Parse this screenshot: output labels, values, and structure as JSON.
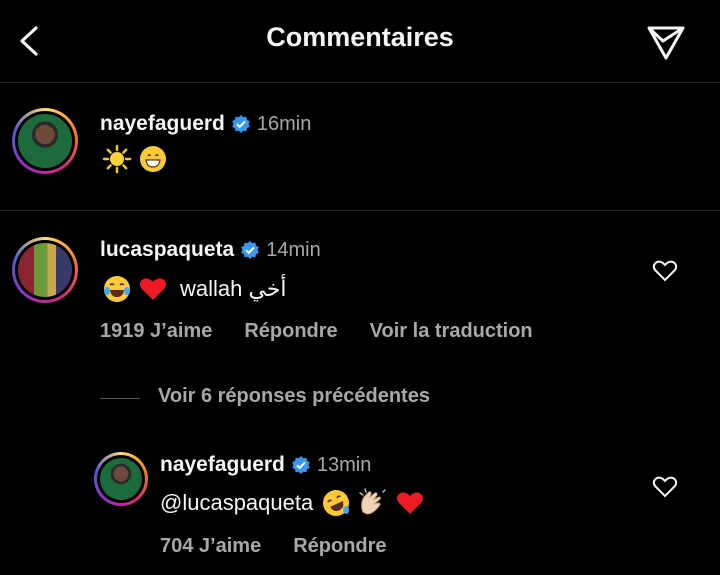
{
  "header": {
    "title": "Commentaires",
    "back_icon": "chevron-left-icon",
    "share_icon": "send-icon"
  },
  "caption": {
    "username": "nayefaguerd",
    "time": "16min",
    "emojis": [
      "sun-emoji",
      "grinning-face-emoji"
    ]
  },
  "comment": {
    "username": "lucaspaqueta",
    "time": "14min",
    "text": "wallah أخي",
    "emojis": [
      "tears-of-joy-emoji",
      "red-heart-emoji"
    ],
    "likes": "1919 J’aime",
    "reply": "Répondre",
    "translate": "Voir la traduction"
  },
  "view_replies": "Voir 6 réponses précédentes",
  "reply": {
    "username": "nayefaguerd",
    "time": "13min",
    "mention": "@lucaspaqueta",
    "emojis": [
      "rolling-laughing-emoji",
      "clapping-hands-emoji",
      "red-heart-emoji"
    ],
    "likes": "704 J’aime",
    "reply_label": "Répondre"
  },
  "colors": {
    "background": "#000000",
    "text": "#f5f5f5",
    "muted": "#a8a8a8",
    "verified": "#3897f0",
    "heart": "#ed1c24"
  }
}
